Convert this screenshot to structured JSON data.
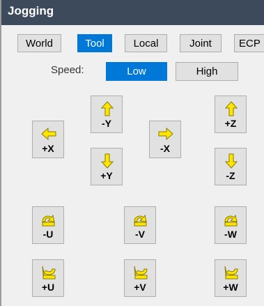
{
  "window": {
    "title": "Jogging"
  },
  "modes": [
    "World",
    "Tool",
    "Local",
    "Joint",
    "ECP"
  ],
  "active_mode": "Tool",
  "speed": {
    "label": "Speed:",
    "low": "Low",
    "high": "High",
    "selected": "Low"
  },
  "jog": {
    "plus_x": "+X",
    "minus_y": "-Y",
    "plus_y": "+Y",
    "minus_x": "-X",
    "plus_z": "+Z",
    "minus_z": "-Z",
    "minus_u": "-U",
    "minus_v": "-V",
    "minus_w": "-W",
    "plus_u": "+U",
    "plus_v": "+V",
    "plus_w": "+W"
  },
  "colors": {
    "title_bar": "#3d4a5c",
    "accent": "#0078d7",
    "arrow_fill": "#ffe600",
    "arrow_stroke": "#8a7a00"
  }
}
